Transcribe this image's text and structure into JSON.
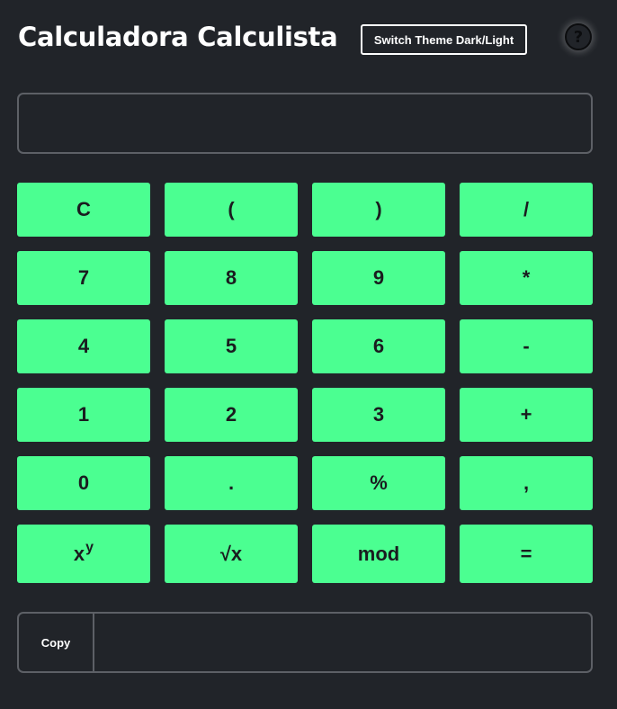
{
  "header": {
    "title": "Calculadora Calculista",
    "theme_button_label": "Switch Theme Dark/Light",
    "help_glyph": "?",
    "help_icon": "question-circle-icon"
  },
  "display": {
    "value": "",
    "placeholder": ""
  },
  "keypad": {
    "rows": [
      [
        "C",
        "(",
        ")",
        "/"
      ],
      [
        "7",
        "8",
        "9",
        "*"
      ],
      [
        "4",
        "5",
        "6",
        "-"
      ],
      [
        "1",
        "2",
        "3",
        "+"
      ],
      [
        "0",
        ".",
        "%",
        ","
      ],
      [
        "x^y",
        "√x",
        "mod",
        "="
      ]
    ],
    "power_base": "x",
    "power_exponent": "y",
    "sqrt_label": "√x",
    "mod_label": "mod",
    "equals_label": "="
  },
  "copy": {
    "button_label": "Copy",
    "output_value": ""
  },
  "colors": {
    "background": "#212429",
    "key": "#4bff91",
    "key_text": "#1a1c1f",
    "border": "#5d6066",
    "text": "#ffffff"
  }
}
